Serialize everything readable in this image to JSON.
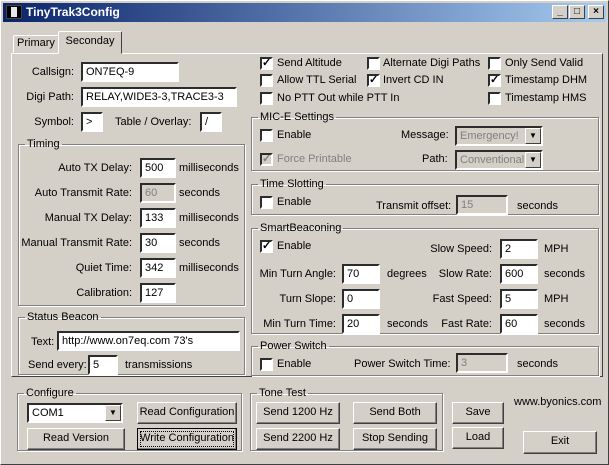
{
  "window": {
    "title": "TinyTrak3Config"
  },
  "title_buttons": {
    "minimize": "_",
    "maximize": "□",
    "close": "×"
  },
  "tabs": [
    {
      "label": "Primary"
    },
    {
      "label": "Seconday"
    }
  ],
  "general": {
    "callsign_label": "Callsign:",
    "callsign_value": "ON7EQ-9",
    "digi_label": "Digi Path:",
    "digi_value": "RELAY,WIDE3-3,TRACE3-3",
    "symbol_label": "Symbol:",
    "symbol_value": ">",
    "table_label": "Table / Overlay:",
    "table_value": "/"
  },
  "timing": {
    "legend": "Timing",
    "rows": [
      {
        "label": "Auto TX Delay:",
        "value": "500",
        "unit": "milliseconds"
      },
      {
        "label": "Auto Transmit Rate:",
        "value": "60",
        "unit": "seconds"
      },
      {
        "label": "Manual TX Delay:",
        "value": "133",
        "unit": "milliseconds"
      },
      {
        "label": "Manual Transmit Rate:",
        "value": "30",
        "unit": "seconds"
      },
      {
        "label": "Quiet Time:",
        "value": "342",
        "unit": "milliseconds"
      },
      {
        "label": "Calibration:",
        "value": "127",
        "unit": ""
      }
    ]
  },
  "status": {
    "legend": "Status Beacon",
    "text_label": "Text:",
    "text_value": "http://www.on7eq.com  73's",
    "every_label": "Send every:",
    "every_value": "5",
    "every_unit": "transmissions"
  },
  "options": {
    "send_altitude": "Send Altitude",
    "alt_digi": "Alternate Digi Paths",
    "only_valid": "Only Send Valid",
    "allow_ttl": "Allow TTL Serial",
    "invert_cd": "Invert CD IN",
    "timestamp_dhm": "Timestamp DHM",
    "no_ptt": "No PTT Out while PTT In",
    "timestamp_hms": "Timestamp HMS"
  },
  "mice": {
    "legend": "MIC-E Settings",
    "enable": "Enable",
    "message_label": "Message:",
    "message_value": "Emergency!",
    "force": "Force Printable",
    "path_label": "Path:",
    "path_value": "Conventional"
  },
  "slotting": {
    "legend": "Time Slotting",
    "enable": "Enable",
    "offset_label": "Transmit offset:",
    "offset_value": "15",
    "offset_unit": "seconds"
  },
  "smart": {
    "legend": "SmartBeaconing",
    "enable": "Enable",
    "slow_speed_label": "Slow Speed:",
    "slow_speed_value": "2",
    "slow_speed_unit": "MPH",
    "min_angle_label": "Min Turn Angle:",
    "min_angle_value": "70",
    "min_angle_unit": "degrees",
    "slow_rate_label": "Slow Rate:",
    "slow_rate_value": "600",
    "slow_rate_unit": "seconds",
    "turn_slope_label": "Turn Slope:",
    "turn_slope_value": "0",
    "fast_speed_label": "Fast Speed:",
    "fast_speed_value": "5",
    "fast_speed_unit": "MPH",
    "min_time_label": "Min Turn Time:",
    "min_time_value": "20",
    "min_time_unit": "seconds",
    "fast_rate_label": "Fast Rate:",
    "fast_rate_value": "60",
    "fast_rate_unit": "seconds"
  },
  "power": {
    "legend": "Power Switch",
    "enable": "Enable",
    "time_label": "Power Switch Time:",
    "time_value": "3",
    "time_unit": "seconds"
  },
  "configure": {
    "legend": "Configure",
    "port": "COM1",
    "read_config": "Read Configuration",
    "read_version": "Read Version",
    "write_config": "Write Configuration"
  },
  "tone": {
    "legend": "Tone Test",
    "send1200": "Send 1200 Hz",
    "send_both": "Send Both",
    "send2200": "Send 2200 Hz",
    "stop": "Stop Sending"
  },
  "actions": {
    "save": "Save",
    "load": "Load",
    "exit": "Exit"
  },
  "website": "www.byonics.com",
  "check_mark": "✓",
  "dropdown_arrow": "▼"
}
